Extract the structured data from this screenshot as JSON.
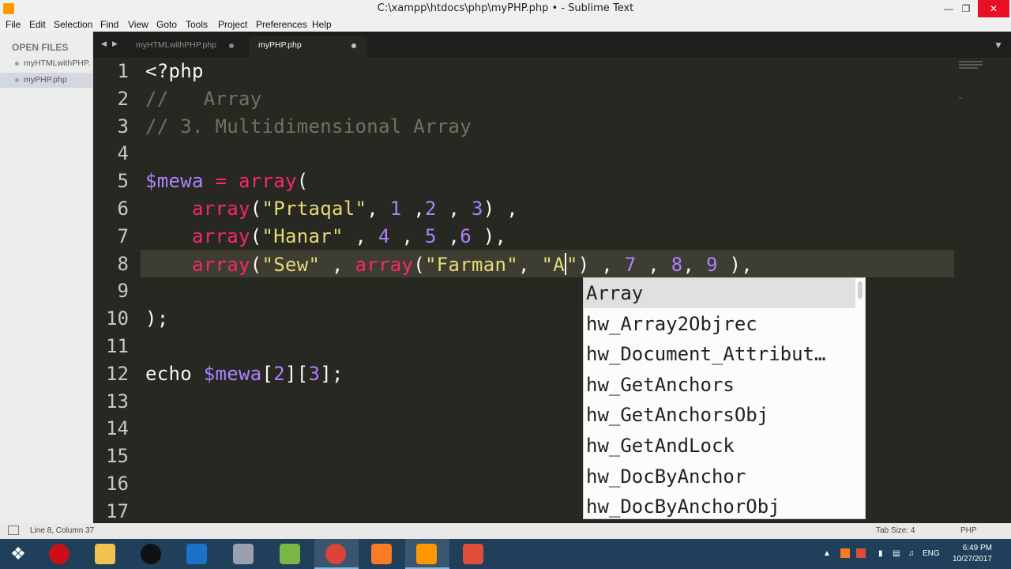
{
  "window": {
    "title": "C:\\xampp\\htdocs\\php\\myPHP.php • - Sublime Text"
  },
  "menu": [
    "File",
    "Edit",
    "Selection",
    "Find",
    "View",
    "Goto",
    "Tools",
    "Project",
    "Preferences",
    "Help"
  ],
  "sidebar": {
    "header": "OPEN FILES",
    "files": [
      "myHTMLwithPHP.",
      "myPHP.php"
    ]
  },
  "tabs": [
    {
      "label": "myHTMLwithPHP.php",
      "active": false
    },
    {
      "label": "myPHP.php",
      "active": true
    }
  ],
  "editor": {
    "line_numbers": [
      "1",
      "2",
      "3",
      "4",
      "5",
      "6",
      "7",
      "8",
      "9",
      "10",
      "11",
      "12",
      "13",
      "14",
      "15",
      "16",
      "17"
    ],
    "current_line": 8,
    "lines": [
      [
        {
          "t": "<?php",
          "c": "tag"
        }
      ],
      [
        {
          "t": "//   Array",
          "c": "cmt"
        }
      ],
      [
        {
          "t": "// 3. Multidimensional Array",
          "c": "cmt"
        }
      ],
      [],
      [
        {
          "t": "$mewa",
          "c": "var"
        },
        {
          "t": " = ",
          "c": "op"
        },
        {
          "t": "array",
          "c": "fn"
        },
        {
          "t": "(",
          "c": "pl"
        }
      ],
      [
        {
          "t": "    ",
          "c": "pl"
        },
        {
          "t": "array",
          "c": "fn"
        },
        {
          "t": "(",
          "c": "pl"
        },
        {
          "t": "\"Prtaqal\"",
          "c": "str"
        },
        {
          "t": ", ",
          "c": "pl"
        },
        {
          "t": "1",
          "c": "num"
        },
        {
          "t": " ,",
          "c": "pl"
        },
        {
          "t": "2",
          "c": "num"
        },
        {
          "t": " , ",
          "c": "pl"
        },
        {
          "t": "3",
          "c": "num"
        },
        {
          "t": ") ,",
          "c": "pl"
        }
      ],
      [
        {
          "t": "    ",
          "c": "pl"
        },
        {
          "t": "array",
          "c": "fn"
        },
        {
          "t": "(",
          "c": "pl"
        },
        {
          "t": "\"Hanar\"",
          "c": "str"
        },
        {
          "t": " , ",
          "c": "pl"
        },
        {
          "t": "4",
          "c": "num"
        },
        {
          "t": " , ",
          "c": "pl"
        },
        {
          "t": "5",
          "c": "num"
        },
        {
          "t": " ,",
          "c": "pl"
        },
        {
          "t": "6",
          "c": "num"
        },
        {
          "t": " ),",
          "c": "pl"
        }
      ],
      [
        {
          "t": "    ",
          "c": "pl"
        },
        {
          "t": "array",
          "c": "fn"
        },
        {
          "t": "(",
          "c": "pl"
        },
        {
          "t": "\"Sew\"",
          "c": "str"
        },
        {
          "t": " , ",
          "c": "pl"
        },
        {
          "t": "array",
          "c": "fn"
        },
        {
          "t": "(",
          "c": "pl"
        },
        {
          "t": "\"Farman\"",
          "c": "str"
        },
        {
          "t": ", ",
          "c": "pl"
        },
        {
          "t": "\"A",
          "c": "str"
        },
        {
          "t": "|",
          "c": "caret"
        },
        {
          "t": "\"",
          "c": "str"
        },
        {
          "t": ") , ",
          "c": "pl"
        },
        {
          "t": "7",
          "c": "num"
        },
        {
          "t": " , ",
          "c": "pl"
        },
        {
          "t": "8",
          "c": "num"
        },
        {
          "t": ", ",
          "c": "pl"
        },
        {
          "t": "9",
          "c": "num"
        },
        {
          "t": " ),",
          "c": "pl"
        }
      ],
      [],
      [
        {
          "t": ");",
          "c": "pl"
        }
      ],
      [],
      [
        {
          "t": "echo ",
          "c": "pl"
        },
        {
          "t": "$mewa",
          "c": "var"
        },
        {
          "t": "[",
          "c": "pl"
        },
        {
          "t": "2",
          "c": "num"
        },
        {
          "t": "][",
          "c": "pl"
        },
        {
          "t": "3",
          "c": "num"
        },
        {
          "t": "];",
          "c": "pl"
        }
      ],
      [],
      [],
      [],
      [],
      []
    ]
  },
  "autocomplete": {
    "items": [
      "Array",
      "hw_Array2Objrec",
      "hw_Document_Attribut…",
      "hw_GetAnchors",
      "hw_GetAnchorsObj",
      "hw_GetAndLock",
      "hw_DocByAnchor",
      "hw_DocByAnchorObj"
    ],
    "selected_index": 0
  },
  "status": {
    "position": "Line 8, Column 37",
    "tab_size": "Tab Size: 4",
    "syntax": "PHP"
  },
  "taskbar": {
    "language": "ENG",
    "time": "6:49 PM",
    "date": "10/27/2017"
  },
  "colors": {
    "editor_bg": "#272822",
    "comment": "#75715e",
    "keyword": "#f92672",
    "string": "#e6db74",
    "number": "#ae81ff"
  }
}
